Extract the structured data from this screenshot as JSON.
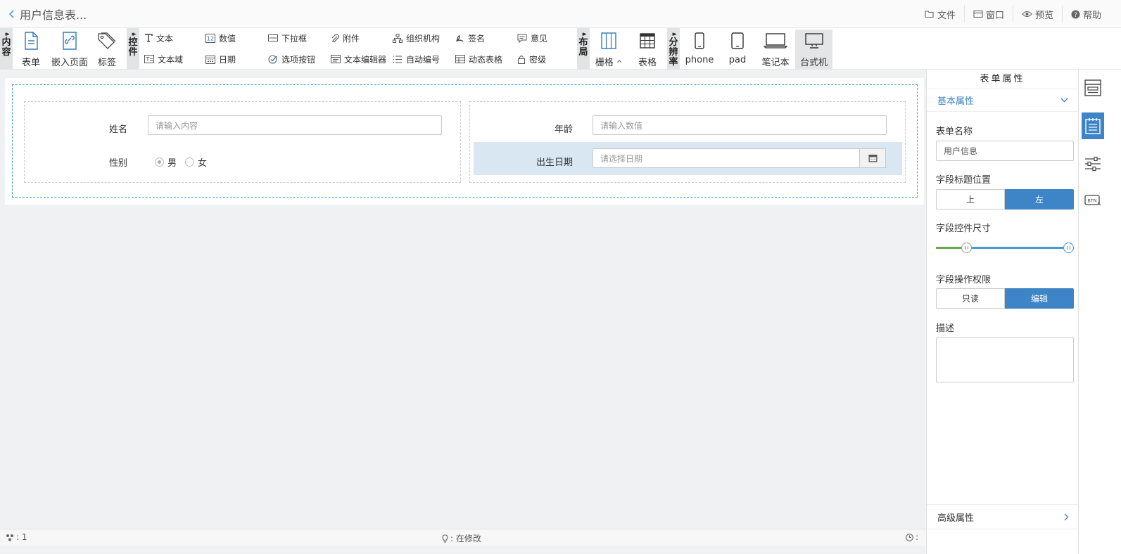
{
  "header": {
    "title": "用户信息表...",
    "menu": [
      {
        "label": "文件",
        "icon": "folder-icon"
      },
      {
        "label": "窗口",
        "icon": "window-icon"
      },
      {
        "label": "预览",
        "icon": "eye-icon"
      },
      {
        "label": "帮助",
        "icon": "help-icon"
      }
    ]
  },
  "toolbar": {
    "groups": {
      "content": "内容",
      "controls": "控件",
      "layout": "布局",
      "resolution": "分辨率"
    },
    "content_items": [
      "表单",
      "嵌入页面",
      "标签"
    ],
    "controls_row1": [
      "文本",
      "数值",
      "下拉框",
      "附件",
      "组织机构",
      "签名",
      "意见"
    ],
    "controls_row2": [
      "文本域",
      "日期",
      "选项按钮",
      "文本编辑器",
      "自动编号",
      "动态表格",
      "密级"
    ],
    "layout_items": [
      "栅格",
      "表格"
    ],
    "layout_grid_caret": "^",
    "resolution_items": [
      "phone",
      "pad",
      "笔记本",
      "台式机"
    ],
    "resolution_selected": "台式机"
  },
  "form": {
    "name_label": "姓名",
    "name_placeholder": "请输入内容",
    "age_label": "年龄",
    "age_placeholder": "请输入数值",
    "gender_label": "性别",
    "gender_options": [
      "男",
      "女"
    ],
    "gender_selected": "男",
    "birth_label": "出生日期",
    "birth_placeholder": "请选择日期"
  },
  "panel": {
    "title": "表单属性",
    "basic_section": "基本属性",
    "form_name_label": "表单名称",
    "form_name_value": "用户信息",
    "title_pos_label": "字段标题位置",
    "title_pos_options": [
      "上",
      "左"
    ],
    "title_pos_selected": "左",
    "size_label": "字段控件尺寸",
    "size_range": {
      "low": 0.2,
      "high": 1.0
    },
    "perm_label": "字段操作权限",
    "perm_options": [
      "只读",
      "编辑"
    ],
    "perm_selected": "编辑",
    "desc_label": "描述",
    "advanced_section": "高级属性"
  },
  "rail": [
    "form-layout-icon",
    "form-props-icon",
    "sliders-icon",
    "btn-icon"
  ],
  "status": {
    "left": ": 1",
    "center": ": 在修改",
    "right": ":"
  },
  "colors": {
    "accent": "#3d85c6",
    "highlight_row": "#d8e7f2",
    "dashed_border": "#4a9ad5"
  }
}
